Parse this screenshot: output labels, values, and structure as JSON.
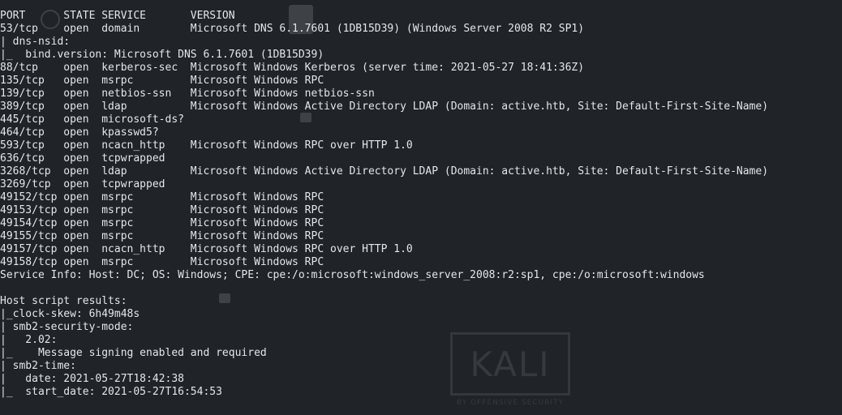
{
  "terminal": {
    "lines": [
      "PORT      STATE SERVICE       VERSION",
      "53/tcp    open  domain        Microsoft DNS 6.1.7601 (1DB15D39) (Windows Server 2008 R2 SP1)",
      "| dns-nsid:",
      "|_  bind.version: Microsoft DNS 6.1.7601 (1DB15D39)",
      "88/tcp    open  kerberos-sec  Microsoft Windows Kerberos (server time: 2021-05-27 18:41:36Z)",
      "135/tcp   open  msrpc         Microsoft Windows RPC",
      "139/tcp   open  netbios-ssn   Microsoft Windows netbios-ssn",
      "389/tcp   open  ldap          Microsoft Windows Active Directory LDAP (Domain: active.htb, Site: Default-First-Site-Name)",
      "445/tcp   open  microsoft-ds?",
      "464/tcp   open  kpasswd5?",
      "593/tcp   open  ncacn_http    Microsoft Windows RPC over HTTP 1.0",
      "636/tcp   open  tcpwrapped",
      "3268/tcp  open  ldap          Microsoft Windows Active Directory LDAP (Domain: active.htb, Site: Default-First-Site-Name)",
      "3269/tcp  open  tcpwrapped",
      "49152/tcp open  msrpc         Microsoft Windows RPC",
      "49153/tcp open  msrpc         Microsoft Windows RPC",
      "49154/tcp open  msrpc         Microsoft Windows RPC",
      "49155/tcp open  msrpc         Microsoft Windows RPC",
      "49157/tcp open  ncacn_http    Microsoft Windows RPC over HTTP 1.0",
      "49158/tcp open  msrpc         Microsoft Windows RPC",
      "Service Info: Host: DC; OS: Windows; CPE: cpe:/o:microsoft:windows_server_2008:r2:sp1, cpe:/o:microsoft:windows",
      "",
      "Host script results:",
      "|_clock-skew: 6h49m48s",
      "| smb2-security-mode:",
      "|   2.02:",
      "|_    Message signing enabled and required",
      "| smb2-time:",
      "|   date: 2021-05-27T18:42:38",
      "|_  start_date: 2021-05-27T16:54:53"
    ]
  },
  "desktop": {
    "watermark_text": "KALI",
    "watermark_subtext": "BY OFFENSIVE SECURITY"
  },
  "colors": {
    "background": "#202327",
    "text": "#e4e6e9"
  }
}
